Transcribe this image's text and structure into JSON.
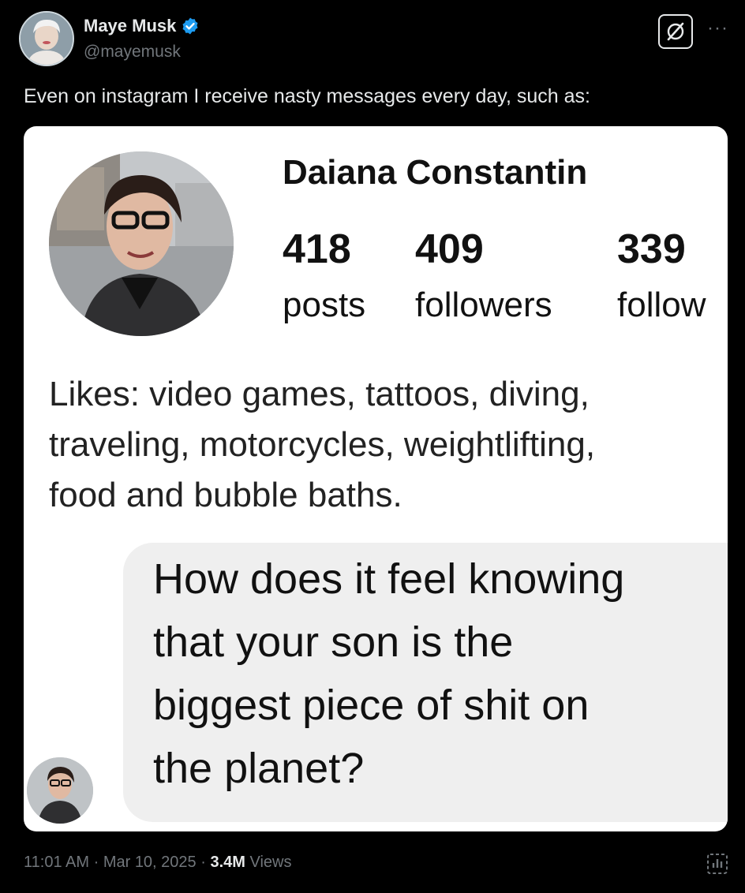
{
  "author": {
    "display_name": "Maye Musk",
    "handle": "@mayemusk"
  },
  "tweet": {
    "text": "Even on instagram I receive nasty messages every day, such as:",
    "time": "11:01 AM",
    "date": "Mar 10, 2025",
    "views_count": "3.4M",
    "views_label": "Views"
  },
  "profile": {
    "name": "Daiana Constantin",
    "stats": [
      {
        "value": "418",
        "label": "posts"
      },
      {
        "value": "409",
        "label": "followers"
      },
      {
        "value": "339",
        "label": "follow"
      }
    ],
    "bio_lines": [
      "Likes: video games, tattoos, diving,",
      "traveling, motorcycles, weightlifting,",
      "food and bubble baths."
    ]
  },
  "dm": {
    "lines": [
      "How does it feel knowing",
      "that your son is the",
      "biggest piece of shit on",
      "the planet?"
    ]
  },
  "colors": {
    "background": "#000000",
    "text_primary": "#e7e9ea",
    "text_secondary": "#71767b",
    "verified_blue": "#1d9bf0",
    "dm_bubble": "#efefef"
  },
  "icons": [
    "verified-badge-icon",
    "grok-icon",
    "more-icon",
    "analytics-icon"
  ]
}
